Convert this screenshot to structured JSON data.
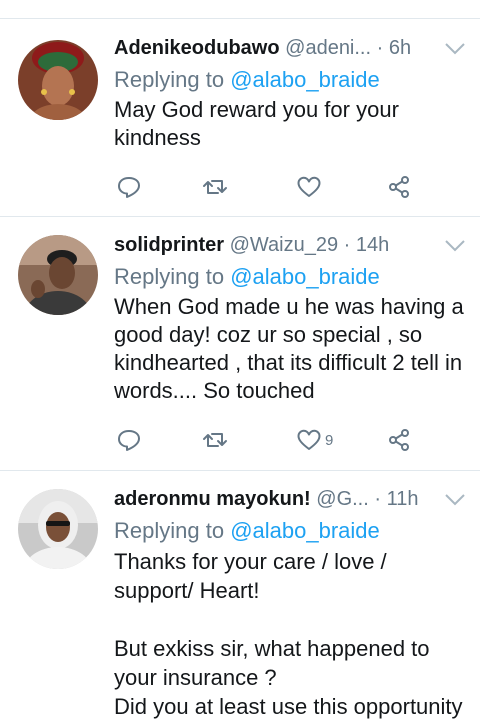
{
  "tweets": [
    {
      "name": "Adenikeodubawo",
      "handle": "@adeni...",
      "time": "· 6h",
      "replying_label": "Replying to",
      "mention": "@alabo_braide",
      "text": "May God reward you for your kindness",
      "like_count": ""
    },
    {
      "name": "solidprinter",
      "handle": "@Waizu_29",
      "time": "· 14h",
      "replying_label": "Replying to",
      "mention": "@alabo_braide",
      "text": "When God made u he was having a good day! coz ur so special , so kindhearted , that its difficult 2 tell in words.... So touched",
      "like_count": "9"
    },
    {
      "name": "aderonmu mayokun!",
      "handle": "@G...",
      "time": "· 11h",
      "replying_label": "Replying to",
      "mention": "@alabo_braide",
      "text": "Thanks for your care / love / support/ Heart!\n\nBut exkiss sir, what happened to your insurance ?\nDid you at least use this opportunity",
      "like_count": ""
    }
  ],
  "colors": {
    "accent": "#1da1f2",
    "muted": "#657786",
    "text": "#14171a",
    "divider": "#e1e8ed"
  },
  "icons": [
    "reply-icon",
    "retweet-icon",
    "like-icon",
    "share-icon",
    "chevron-down-icon"
  ]
}
